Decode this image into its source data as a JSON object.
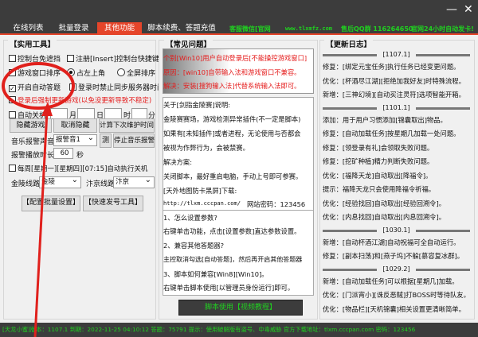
{
  "tabs": [
    "在线列表",
    "批量登录",
    "其他功能",
    "脚本续费、答题充值"
  ],
  "promo": {
    "wechat": "客服微信[官网",
    "site": "www.tlxmfz.com",
    "qq": "售后QQ群 116264650",
    "auto": "官网24小时自动发卡!"
  },
  "window": {
    "minimize": "—",
    "close": "✕"
  },
  "left": {
    "section": "【实用工具】",
    "cb_console": "控制台免遮挡",
    "cb_insert": "注册[Insert]控制台快捷键",
    "cb_sort": "游戏窗口排序",
    "rb_topleft": "占左上角",
    "rb_full": "全屏排序",
    "cb_answer": "开启自动答题",
    "cb_sync": "登录时禁止同步服务器时间",
    "cb_force": "登录后强制更新游戏(以免没更新导致不稳定)",
    "cb_shutdown": "自动关机",
    "month": "月",
    "day": "日",
    "hour": "时",
    "minute": "分",
    "btn_hide": "隐藏游戏",
    "btn_unhide": "取消隐藏",
    "btn_calc": "计算下次维护时间",
    "music_label": "音乐报警声音",
    "music_value": "报警音1",
    "btn_test": "测",
    "btn_stop": "停止音乐报警",
    "duration_label": "报警播放时长",
    "duration_value": "60",
    "seconds": "秒",
    "cb_weekly": "每周[星期一][星期四][07:15]自动执行关机",
    "jinling_label": "金陵线路",
    "jinling_value": "金陵",
    "bianjing_label": "汴京线路",
    "bianjing_value": "汴京",
    "btn_batch": "【配置批量设置】",
    "btn_quick": "【快速发号工具】"
  },
  "middle": {
    "section": "【常见问题】",
    "notice": [
      "个别[Win10]用户自动登录后[不能操控游戏窗口]",
      "原因：[win10]自带输入法和游戏窗口不兼容。",
      "解决：安装[搜狗输入法]代替系统输入法即可。"
    ],
    "lines1": [
      "关于[剑指金陵赛]说明:",
      "金陵赛赛场，游戏检测异常插件(不一定是脚本)",
      "如果有[未知插件]或者进程，无论使用与否都会",
      "被视为作弊行为，会被禁赛。",
      "解决方案:",
      "关闭脚本，最好重启电脑，手动上号即可参赛。",
      "[天外地图防卡黑屏]下载:"
    ],
    "url": "http://tlxm.cccpan.com/",
    "url_pw": "网站密码：123456",
    "lines2": [
      "1、怎么设置参数?",
      "右键单击功能，点击[设置参数]直达参数设置。",
      "2、兼容其他答题器?",
      "主控取消勾选[自动答题]，然后再开启其他答题器",
      "3、脚本如何兼容[Win8][Win10]。",
      "右键单击脚本使用[以管理员身份运行]即可。"
    ],
    "video_btn": "脚本使用【视频教程】"
  },
  "right": {
    "section": "【更新日志】",
    "groups": [
      {
        "ver": "[1107.1]",
        "items": [
          "修复：[绑定元宝任务]执行任务已经变更问题。",
          "优化：[杯酒尽江湖][拒绝加我好友]时特殊流程。",
          "新增：[三神幻境][自动买注灵符]选项智能开箱。"
        ]
      },
      {
        "ver": "[1101.1]",
        "items": [
          "添加：用于用户习惯添加[锦囊取出]物品。",
          "修复：[自动加载任务]按星期几加载一处问题。",
          "修复：[领登录有礼]会领取失败问题。",
          "修复：[挖矿种植]精力判断失败问题。",
          "优化：[福降天龙]自动取出[降福令]。",
          "提示：福降天龙只会使用降福令祈福。",
          "优化：[经验找回]自动取出[经验回溯令]。",
          "优化：[内息找回]自动取出[内息回溯令]。"
        ]
      },
      {
        "ver": "[1030.1]",
        "items": [
          "新增：[自动杯酒江湖]自动祝福可全自动运行。",
          "修复：[副本扫荡]和[燕子坞]不躲[慕容复冰群]。"
        ]
      },
      {
        "ver": "[1029.2]",
        "items": [
          "新增：[自动加载任务]可以根据[星期几]加载。",
          "优化：[门派宵小][诛反恶贼]打BOSS时等待队友。",
          "优化：[物品栏][天机锦囊]相关设置更清晰简单。"
        ]
      }
    ]
  },
  "status": {
    "version": "[天龙小蜜]版本：1107.1",
    "expire": "到期：2022-11-25 04:10:12",
    "answers": "答题：75791",
    "tip": "提示：使用破解版有盗号、中毒威胁 官方下载地址：tlxm.cccpan.com 密码：123456"
  },
  "colors": {
    "accent": "#e5452a",
    "green": "#20d020",
    "dark": "#3c3c3c",
    "annotation": "#e0201c"
  }
}
